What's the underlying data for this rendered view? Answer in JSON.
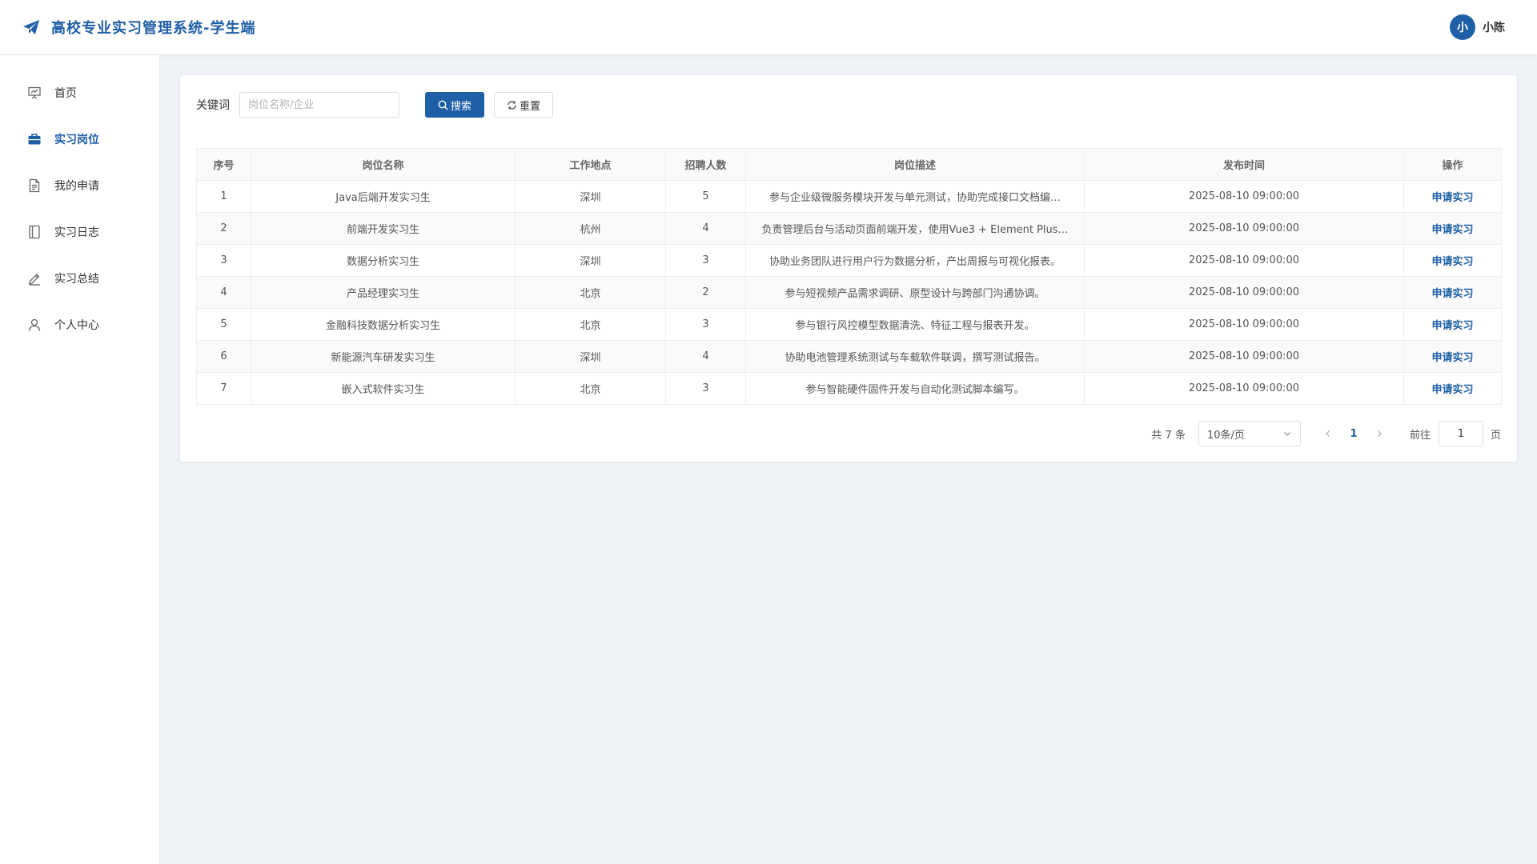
{
  "header": {
    "title": "高校专业实习管理系统-学生端",
    "logo_icon": "paper-plane-icon",
    "user": {
      "avatar_text": "小",
      "name": "小陈"
    }
  },
  "sidebar": {
    "items": [
      {
        "label": "首页",
        "icon": "presentation-icon",
        "active": false
      },
      {
        "label": "实习岗位",
        "icon": "briefcase-icon",
        "active": true
      },
      {
        "label": "我的申请",
        "icon": "document-icon",
        "active": false
      },
      {
        "label": "实习日志",
        "icon": "notebook-icon",
        "active": false
      },
      {
        "label": "实习总结",
        "icon": "edit-pen-icon",
        "active": false
      },
      {
        "label": "个人中心",
        "icon": "user-icon",
        "active": false
      }
    ]
  },
  "search": {
    "label": "关键词",
    "placeholder": "岗位名称/企业",
    "value": "",
    "search_button": "搜索",
    "reset_button": "重置"
  },
  "table": {
    "columns": [
      "序号",
      "岗位名称",
      "工作地点",
      "招聘人数",
      "岗位描述",
      "发布时间",
      "操作"
    ],
    "action_label": "申请实习",
    "rows": [
      {
        "no": "1",
        "name": "Java后端开发实习生",
        "location": "深圳",
        "count": "5",
        "desc": "参与企业级微服务模块开发与单元测试，协助完成接口文档编…",
        "time": "2025-08-10 09:00:00"
      },
      {
        "no": "2",
        "name": "前端开发实习生",
        "location": "杭州",
        "count": "4",
        "desc": "负责管理后台与活动页面前端开发，使用Vue3 + Element Plus…",
        "time": "2025-08-10 09:00:00"
      },
      {
        "no": "3",
        "name": "数据分析实习生",
        "location": "深圳",
        "count": "3",
        "desc": "协助业务团队进行用户行为数据分析，产出周报与可视化报表。",
        "time": "2025-08-10 09:00:00"
      },
      {
        "no": "4",
        "name": "产品经理实习生",
        "location": "北京",
        "count": "2",
        "desc": "参与短视频产品需求调研、原型设计与跨部门沟通协调。",
        "time": "2025-08-10 09:00:00"
      },
      {
        "no": "5",
        "name": "金融科技数据分析实习生",
        "location": "北京",
        "count": "3",
        "desc": "参与银行风控模型数据清洗、特征工程与报表开发。",
        "time": "2025-08-10 09:00:00"
      },
      {
        "no": "6",
        "name": "新能源汽车研发实习生",
        "location": "深圳",
        "count": "4",
        "desc": "协助电池管理系统测试与车载软件联调，撰写测试报告。",
        "time": "2025-08-10 09:00:00"
      },
      {
        "no": "7",
        "name": "嵌入式软件实习生",
        "location": "北京",
        "count": "3",
        "desc": "参与智能硬件固件开发与自动化测试脚本编写。",
        "time": "2025-08-10 09:00:00"
      }
    ]
  },
  "pagination": {
    "total_text": "共 7 条",
    "page_size": "10条/页",
    "current_page": "1",
    "goto_label": "前往",
    "goto_value": "1",
    "goto_unit": "页"
  },
  "colors": {
    "accent": "#1f5fa8",
    "background": "#eff2f7"
  }
}
